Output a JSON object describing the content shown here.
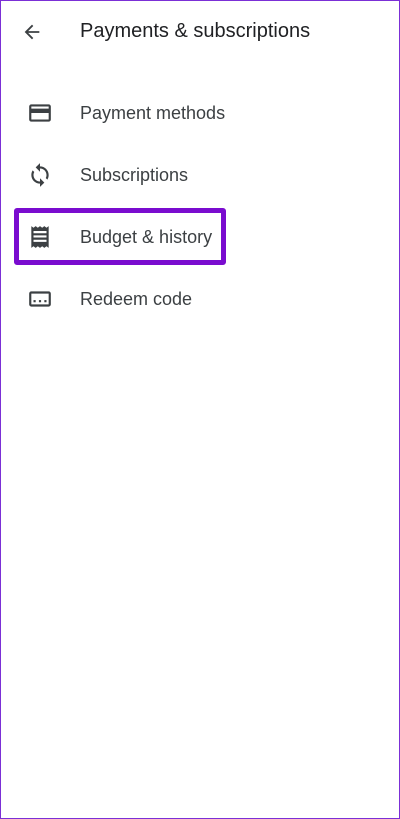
{
  "header": {
    "title": "Payments & subscriptions",
    "back_icon": "arrow-back-icon"
  },
  "menu": {
    "items": [
      {
        "label": "Payment methods",
        "icon": "credit-card-icon"
      },
      {
        "label": "Subscriptions",
        "icon": "sync-icon"
      },
      {
        "label": "Budget & history",
        "icon": "receipt-icon",
        "highlighted": true
      },
      {
        "label": "Redeem code",
        "icon": "redeem-code-icon"
      }
    ]
  },
  "colors": {
    "highlight": "#7a0ccf",
    "icon": "#3c4043",
    "text": "#202124"
  }
}
